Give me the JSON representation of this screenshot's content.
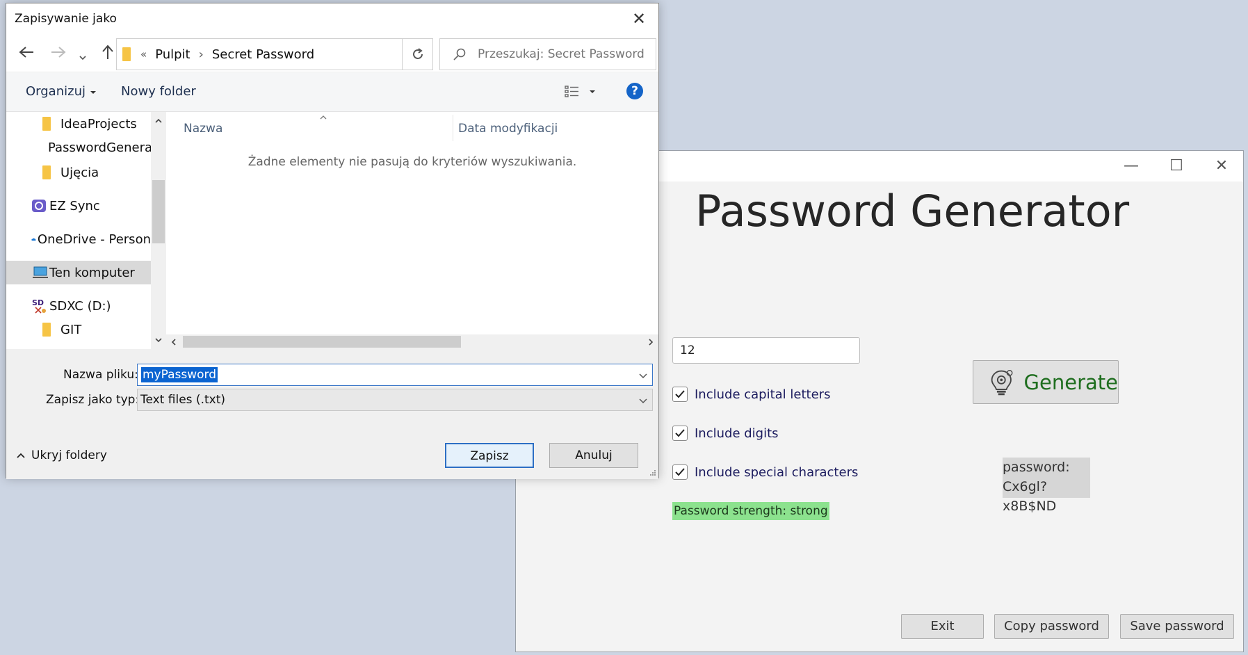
{
  "password_generator": {
    "window_controls": {
      "minimize": "—",
      "maximize": "☐",
      "close": "✕"
    },
    "title": "Password Generator",
    "length_value": "12",
    "options": [
      {
        "label": "Include capital letters",
        "checked": true
      },
      {
        "label": "Include digits",
        "checked": true
      },
      {
        "label": "Include special characters",
        "checked": true
      }
    ],
    "strength_text": "Password strength: strong",
    "generate_label": "Generate",
    "password_label": "password:",
    "password_value": "Cx6gl?x8B$ND",
    "buttons": {
      "exit": "Exit",
      "copy": "Copy password",
      "save": "Save password"
    },
    "colors": {
      "strength_bg": "#8ce28e",
      "generate_text": "#1f6e1f"
    }
  },
  "save_dialog": {
    "title": "Zapisywanie jako",
    "close_glyph": "✕",
    "breadcrumb": {
      "prefix": "«",
      "parent": "Pulpit",
      "separator": "›",
      "current": "Secret Password"
    },
    "search_placeholder": "Przeszukaj: Secret Password",
    "toolbar": {
      "organize": "Organizuj",
      "new_folder": "Nowy folder",
      "help": "?"
    },
    "nav_items": [
      {
        "label": "IdeaProjects",
        "icon": "folder-icon"
      },
      {
        "label": "PasswordGenera",
        "icon": "synced-folder-icon"
      },
      {
        "label": "Ujęcia",
        "icon": "folder-icon"
      },
      {
        "label": "EZ Sync",
        "icon": "ez-sync-icon"
      },
      {
        "label": "OneDrive - Person",
        "icon": "onedrive-icon"
      },
      {
        "label": "Ten komputer",
        "icon": "computer-icon"
      },
      {
        "label": "SDXC (D:)",
        "icon": "sd-card-icon"
      },
      {
        "label": "GIT",
        "icon": "folder-icon"
      }
    ],
    "columns": {
      "name": "Nazwa",
      "modified": "Data modyfikacji"
    },
    "empty_message": "Żadne elementy nie pasują do kryteriów wyszukiwania.",
    "filename_label": "Nazwa pliku:",
    "filename_value": "myPassword",
    "filetype_label": "Zapisz jako typ:",
    "filetype_value": "Text files (.txt)",
    "hide_folders": "Ukryj foldery",
    "save_button": "Zapisz",
    "cancel_button": "Anuluj"
  }
}
